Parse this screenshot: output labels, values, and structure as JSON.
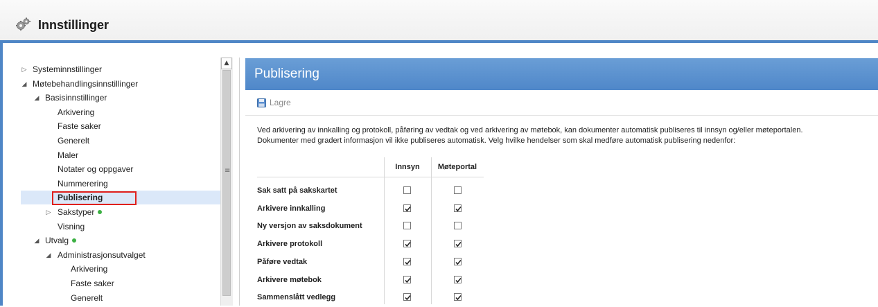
{
  "window": {
    "title": "Innstillinger",
    "icon": "gears-icon"
  },
  "tree": {
    "items": [
      {
        "label": "Systeminnstillinger",
        "arrow": "▷",
        "level": 0
      },
      {
        "label": "Møtebehandlingsinnstillinger",
        "arrow": "◢",
        "level": 0
      },
      {
        "label": "Basisinnstillinger",
        "arrow": "◢",
        "level": 1
      },
      {
        "label": "Arkivering",
        "arrow": "",
        "level": 2
      },
      {
        "label": "Faste saker",
        "arrow": "",
        "level": 2
      },
      {
        "label": "Generelt",
        "arrow": "",
        "level": 2
      },
      {
        "label": "Maler",
        "arrow": "",
        "level": 2
      },
      {
        "label": "Notater og oppgaver",
        "arrow": "",
        "level": 2
      },
      {
        "label": "Nummerering",
        "arrow": "",
        "level": 2
      },
      {
        "label": "Publisering",
        "arrow": "",
        "level": 2,
        "selected": true
      },
      {
        "label": "Sakstyper",
        "arrow": "▷",
        "level": 2,
        "status": "green"
      },
      {
        "label": "Visning",
        "arrow": "",
        "level": 2
      },
      {
        "label": "Utvalg",
        "arrow": "◢",
        "level": 1,
        "status": "green"
      },
      {
        "label": "Administrasjonsutvalget",
        "arrow": "◢",
        "level": 2
      },
      {
        "label": "Arkivering",
        "arrow": "",
        "level": 3
      },
      {
        "label": "Faste saker",
        "arrow": "",
        "level": 3
      },
      {
        "label": "Generelt",
        "arrow": "",
        "level": 3
      }
    ],
    "status_color": "#3cb043",
    "selection_color": "#dbe8f9",
    "highlight_border": "#e0201c"
  },
  "panel": {
    "title": "Publisering",
    "header_color": "#5b93d0",
    "toolbar": {
      "save_label": "Lagre",
      "save_icon": "floppy-disk-icon"
    },
    "description_line1": "Ved arkivering av innkalling og protokoll, påføring av vedtak og ved arkivering av møtebok, kan dokumenter automatisk publiseres til innsyn og/eller møteportalen.",
    "description_line2": "Dokumenter med gradert informasjon vil ikke publiseres automatisk. Velg hvilke hendelser som skal medføre automatisk publisering nedenfor:",
    "table": {
      "columns": [
        "Innsyn",
        "Møteportal"
      ],
      "rows": [
        {
          "label": "Sak satt på sakskartet",
          "innsyn": false,
          "moteportal": false
        },
        {
          "label": "Arkivere innkalling",
          "innsyn": true,
          "moteportal": true
        },
        {
          "label": "Ny versjon av saksdokument",
          "innsyn": false,
          "moteportal": false
        },
        {
          "label": "Arkivere protokoll",
          "innsyn": true,
          "moteportal": true
        },
        {
          "label": "Påføre vedtak",
          "innsyn": true,
          "moteportal": true
        },
        {
          "label": "Arkivere møtebok",
          "innsyn": true,
          "moteportal": true
        },
        {
          "label": "Sammenslått vedlegg",
          "innsyn": true,
          "moteportal": true
        }
      ]
    }
  }
}
